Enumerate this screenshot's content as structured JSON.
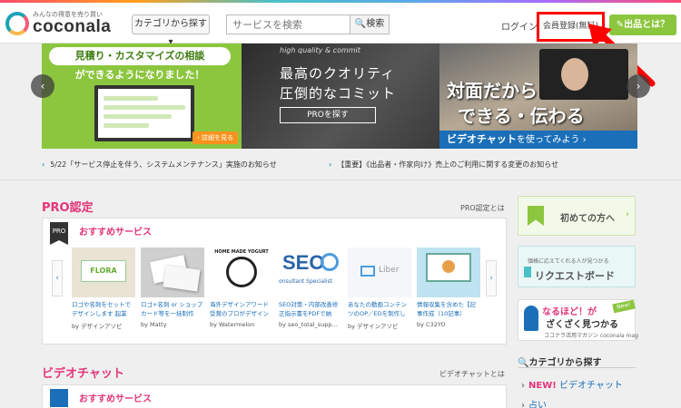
{
  "header": {
    "logo_tagline": "みんなの得意を売り買い",
    "logo_text": "coconala",
    "category_button": "カテゴリから探す ▾",
    "search_placeholder": "サービスを検索",
    "search_button": "🔍検索",
    "login": "ログイン",
    "register": "会員登録(無料)",
    "sell_button": "✎出品とは？"
  },
  "banner": {
    "b1_title": "見積り・カスタマイズの相談",
    "b1_subtitle": "ができるようになりました！",
    "b1_detail": "› 詳細を見る",
    "b2_small": "high quality & commit",
    "b2_line1": "最高のクオリティ",
    "b2_line2": "圧倒的なコミット",
    "b2_button": "PROを探す",
    "b3_line1": "対面だから",
    "b3_line2": "できる・伝わる",
    "b3_bar_bold": "ビデオチャット",
    "b3_bar_rest": "を使ってみよう ›",
    "prev": "‹",
    "next": "›"
  },
  "news": [
    {
      "text": "5/22「サービス停止を伴う、システムメンテナンス」実施のお知らせ"
    },
    {
      "text": "【重要】《出品者・作家向け》売上のご利用に関する変更のお知らせ"
    }
  ],
  "pro_section": {
    "title": "PRO認定",
    "link": "PRO認定とは",
    "badge": "PRO",
    "panel_head": "おすすめサービス",
    "prev": "‹",
    "next": "›",
    "cards": [
      {
        "title": "ロゴや名刺をセットでデザインします 起業",
        "by": "by デザインアソビ"
      },
      {
        "title": "ロゴ+名刺 or ショップカード等を一括制作",
        "by": "by Matty"
      },
      {
        "title": "海外デザインアワード受賞のプロがデザイン",
        "by": "by Watermelon"
      },
      {
        "title": "SEO対策・内部改善修正指示書をPDFで納",
        "by": "by seo_total_supp…"
      },
      {
        "title": "あなたの動画コンテンツのOP／EDを制作し",
        "by": "by デザインアソビ"
      },
      {
        "title": "情報収集を含めた【記事作成（10記事）",
        "by": "by C32YO"
      }
    ],
    "card_texts": {
      "logo_big": "FLORA",
      "seo_line": "onsultant Specialist",
      "liber": "Liber",
      "hand_text": "HOME MADE YOGURT"
    }
  },
  "video_section": {
    "title": "ビデオチャット",
    "link": "ビデオチャットとは",
    "panel_head": "おすすめサービス"
  },
  "sidebar": {
    "first_time": "初めての方へ",
    "request_small": "価格に応えてくれる人が見つかる",
    "request_board": "リクエストボード",
    "naruhodo_line1": "なるほど！が",
    "naruhodo_line2": "ざくざく見つかる",
    "naruhodo_small": "ココナラ活用マガジン coconala mag",
    "new_badge": "New!",
    "category_heading": "🔍カテゴリから探す",
    "categories": [
      {
        "new": "NEW!",
        "label": "ビデオチャット"
      },
      {
        "new": "",
        "label": "占い"
      }
    ]
  }
}
